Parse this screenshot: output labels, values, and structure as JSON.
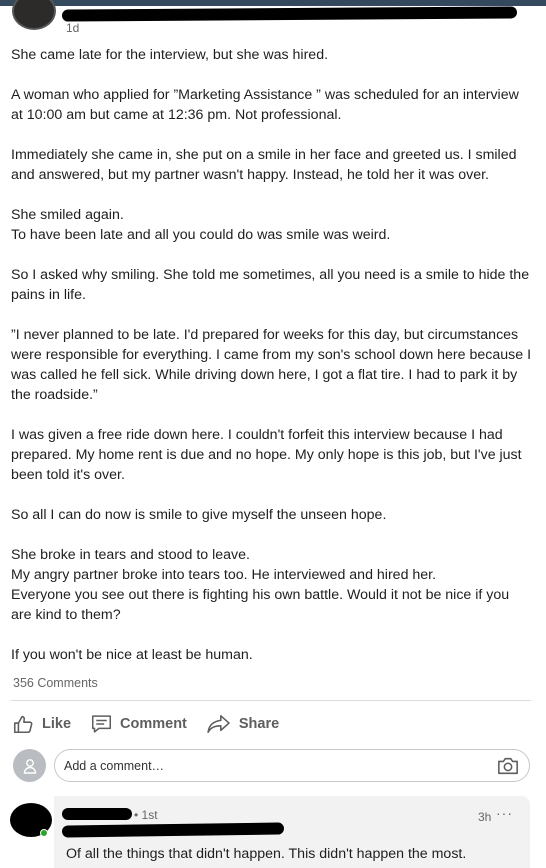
{
  "post": {
    "author_time": "1d",
    "paragraphs": [
      "She came late for the interview, but she was hired.",
      "A woman who applied for ”Marketing Assistance ” was scheduled for an interview at 10:00 am but came at 12:36 pm. Not professional.",
      "Immediately she came in, she put on a smile in her face and greeted us. I smiled and answered, but my partner wasn't happy. Instead, he told her it was over.",
      "She smiled again.",
      "To have been late and all you could do was smile was weird.",
      "So I asked why smiling. She told me sometimes, all you need is a smile to hide the pains in life.",
      "”I never planned to be late. I'd prepared for weeks for this day, but circumstances were responsible for everything. I came from my son's school down here because I was called he fell sick. While driving down here, I  got a flat tire. I had to park it by the roadside.”",
      "I was given a free ride down here. I couldn't forfeit this interview because I had prepared. My home rent is due and no hope. My only hope is this job, but I've just been told it's over.",
      "So all I can do now is smile to give myself the unseen hope.",
      "She broke in tears and stood to leave.",
      "My angry partner broke into tears too. He interviewed and hired her.",
      "Everyone you see out there is fighting his own battle. Would it not be nice if you are kind to them?",
      "If you won't be nice at least be human."
    ],
    "comments_count": "356 Comments"
  },
  "actions": {
    "like": "Like",
    "comment": "Comment",
    "share": "Share"
  },
  "composer": {
    "placeholder": "Add a comment…"
  },
  "comment": {
    "degree": "• 1st",
    "time": "3h",
    "more": "···",
    "text": "Of all the things that didn't happen. This didn't happen the most."
  },
  "colors": {
    "topbar": "#34495e",
    "online": "#2aa52a",
    "card": "#f2f2f2"
  }
}
